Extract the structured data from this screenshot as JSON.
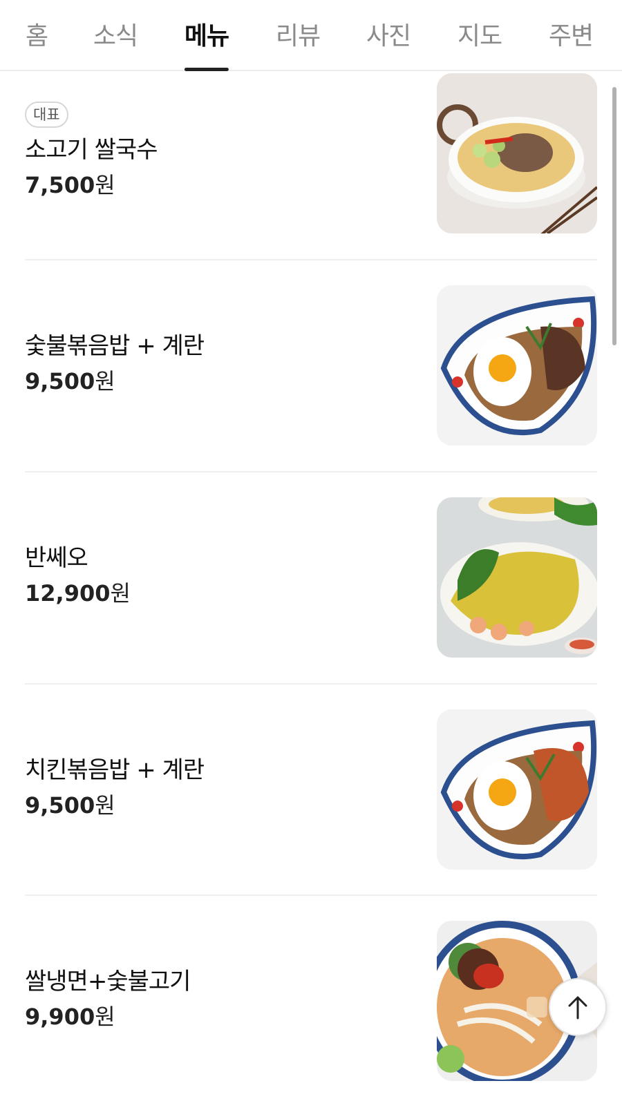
{
  "tabs": [
    {
      "label": "홈",
      "active": false
    },
    {
      "label": "소식",
      "active": false
    },
    {
      "label": "메뉴",
      "active": true
    },
    {
      "label": "리뷰",
      "active": false
    },
    {
      "label": "사진",
      "active": false
    },
    {
      "label": "지도",
      "active": false
    },
    {
      "label": "주변",
      "active": false
    }
  ],
  "menu": {
    "items": [
      {
        "badge": "대표",
        "name": "소고기 쌀국수",
        "price": "7,500",
        "currency": "원",
        "image_icon": "beef-pho-photo"
      },
      {
        "badge": "",
        "name": "숯불볶음밥 + 계란",
        "price": "9,500",
        "currency": "원",
        "image_icon": "charcoal-fried-rice-photo"
      },
      {
        "badge": "",
        "name": "반쎄오",
        "price": "12,900",
        "currency": "원",
        "image_icon": "banh-xeo-photo"
      },
      {
        "badge": "",
        "name": "치킨볶음밥 + 계란",
        "price": "9,500",
        "currency": "원",
        "image_icon": "chicken-fried-rice-photo"
      },
      {
        "badge": "",
        "name": "쌀냉면+숯불고기",
        "price": "9,900",
        "currency": "원",
        "image_icon": "rice-cold-noodle-photo"
      }
    ]
  },
  "colors": {
    "active_tab": "#111111",
    "inactive_tab": "#8a8a8a",
    "divider": "#efefef"
  },
  "scroll_top_icon": "arrow-up-icon"
}
